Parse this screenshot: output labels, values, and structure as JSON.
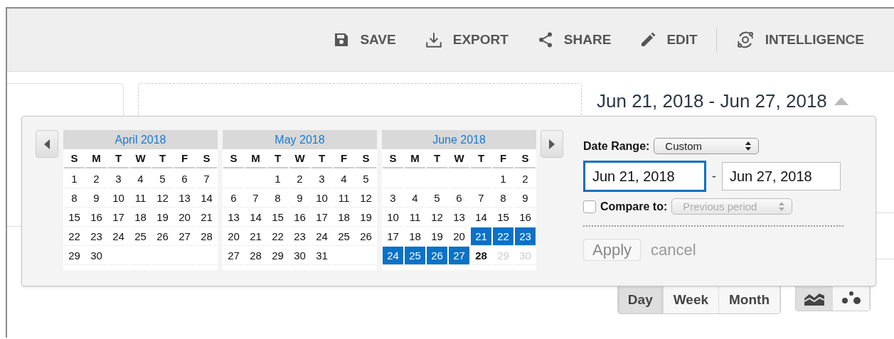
{
  "toolbar": [
    {
      "kind": "save",
      "label": "SAVE"
    },
    {
      "kind": "export",
      "label": "EXPORT"
    },
    {
      "kind": "share",
      "label": "SHARE"
    },
    {
      "kind": "edit",
      "label": "EDIT"
    },
    {
      "kind": "intelligence",
      "label": "INTELLIGENCE"
    }
  ],
  "date_range_display": "Jun 21, 2018 - Jun 27, 2018",
  "picker": {
    "months": [
      {
        "title": "April 2018",
        "weekdays": [
          "S",
          "M",
          "T",
          "W",
          "T",
          "F",
          "S"
        ],
        "weeks": [
          {
            "kind": "full",
            "days": [
              {
                "d": "1",
                "kind": "day",
                "selected": false
              },
              {
                "d": "2",
                "kind": "day",
                "selected": false
              },
              {
                "d": "3",
                "kind": "day",
                "selected": false
              },
              {
                "d": "4",
                "kind": "day",
                "selected": false
              },
              {
                "d": "5",
                "kind": "day",
                "selected": false
              },
              {
                "d": "6",
                "kind": "day",
                "selected": false
              },
              {
                "d": "7",
                "kind": "day",
                "selected": false
              }
            ]
          },
          {
            "kind": "full",
            "days": [
              {
                "d": "8",
                "kind": "day",
                "selected": false
              },
              {
                "d": "9",
                "kind": "day",
                "selected": false
              },
              {
                "d": "10",
                "kind": "day",
                "selected": false
              },
              {
                "d": "11",
                "kind": "day",
                "selected": false
              },
              {
                "d": "12",
                "kind": "day",
                "selected": false
              },
              {
                "d": "13",
                "kind": "day",
                "selected": false
              },
              {
                "d": "14",
                "kind": "day",
                "selected": false
              }
            ]
          },
          {
            "kind": "full",
            "days": [
              {
                "d": "15",
                "kind": "day",
                "selected": false
              },
              {
                "d": "16",
                "kind": "day",
                "selected": false
              },
              {
                "d": "17",
                "kind": "day",
                "selected": false
              },
              {
                "d": "18",
                "kind": "day",
                "selected": false
              },
              {
                "d": "19",
                "kind": "day",
                "selected": false
              },
              {
                "d": "20",
                "kind": "day",
                "selected": false
              },
              {
                "d": "21",
                "kind": "day",
                "selected": false
              }
            ]
          },
          {
            "kind": "full",
            "days": [
              {
                "d": "22",
                "kind": "day",
                "selected": false
              },
              {
                "d": "23",
                "kind": "day",
                "selected": false
              },
              {
                "d": "24",
                "kind": "day",
                "selected": false
              },
              {
                "d": "25",
                "kind": "day",
                "selected": false
              },
              {
                "d": "26",
                "kind": "day",
                "selected": false
              },
              {
                "d": "27",
                "kind": "day",
                "selected": false
              },
              {
                "d": "28",
                "kind": "day",
                "selected": false
              }
            ]
          },
          {
            "kind": "trail",
            "days": [
              {
                "d": "29",
                "kind": "day",
                "selected": false
              },
              {
                "d": "30",
                "kind": "day",
                "selected": false
              }
            ]
          }
        ]
      },
      {
        "title": "May 2018",
        "weekdays": [
          "S",
          "M",
          "T",
          "W",
          "T",
          "F",
          "S"
        ],
        "weeks": [
          {
            "kind": "lead",
            "days": [
              {
                "d": "1",
                "kind": "day",
                "selected": false
              },
              {
                "d": "2",
                "kind": "day",
                "selected": false
              },
              {
                "d": "3",
                "kind": "day",
                "selected": false
              },
              {
                "d": "4",
                "kind": "day",
                "selected": false
              },
              {
                "d": "5",
                "kind": "day",
                "selected": false
              }
            ]
          },
          {
            "kind": "full",
            "days": [
              {
                "d": "6",
                "kind": "day",
                "selected": false
              },
              {
                "d": "7",
                "kind": "day",
                "selected": false
              },
              {
                "d": "8",
                "kind": "day",
                "selected": false
              },
              {
                "d": "9",
                "kind": "day",
                "selected": false
              },
              {
                "d": "10",
                "kind": "day",
                "selected": false
              },
              {
                "d": "11",
                "kind": "day",
                "selected": false
              },
              {
                "d": "12",
                "kind": "day",
                "selected": false
              }
            ]
          },
          {
            "kind": "full",
            "days": [
              {
                "d": "13",
                "kind": "day",
                "selected": false
              },
              {
                "d": "14",
                "kind": "day",
                "selected": false
              },
              {
                "d": "15",
                "kind": "day",
                "selected": false
              },
              {
                "d": "16",
                "kind": "day",
                "selected": false
              },
              {
                "d": "17",
                "kind": "day",
                "selected": false
              },
              {
                "d": "18",
                "kind": "day",
                "selected": false
              },
              {
                "d": "19",
                "kind": "day",
                "selected": false
              }
            ]
          },
          {
            "kind": "full",
            "days": [
              {
                "d": "20",
                "kind": "day",
                "selected": false
              },
              {
                "d": "21",
                "kind": "day",
                "selected": false
              },
              {
                "d": "22",
                "kind": "day",
                "selected": false
              },
              {
                "d": "23",
                "kind": "day",
                "selected": false
              },
              {
                "d": "24",
                "kind": "day",
                "selected": false
              },
              {
                "d": "25",
                "kind": "day",
                "selected": false
              },
              {
                "d": "26",
                "kind": "day",
                "selected": false
              }
            ]
          },
          {
            "kind": "trail",
            "days": [
              {
                "d": "27",
                "kind": "day",
                "selected": false
              },
              {
                "d": "28",
                "kind": "day",
                "selected": false
              },
              {
                "d": "29",
                "kind": "day",
                "selected": false
              },
              {
                "d": "30",
                "kind": "day",
                "selected": false
              },
              {
                "d": "31",
                "kind": "day",
                "selected": false
              }
            ]
          }
        ]
      },
      {
        "title": "June 2018",
        "weekdays": [
          "S",
          "M",
          "T",
          "W",
          "T",
          "F",
          "S"
        ],
        "weeks": [
          {
            "kind": "lead",
            "days": [
              {
                "d": "1",
                "kind": "day",
                "selected": false
              },
              {
                "d": "2",
                "kind": "day",
                "selected": false
              }
            ]
          },
          {
            "kind": "full",
            "days": [
              {
                "d": "3",
                "kind": "day",
                "selected": false
              },
              {
                "d": "4",
                "kind": "day",
                "selected": false
              },
              {
                "d": "5",
                "kind": "day",
                "selected": false
              },
              {
                "d": "6",
                "kind": "day",
                "selected": false
              },
              {
                "d": "7",
                "kind": "day",
                "selected": false
              },
              {
                "d": "8",
                "kind": "day",
                "selected": false
              },
              {
                "d": "9",
                "kind": "day",
                "selected": false
              }
            ]
          },
          {
            "kind": "full",
            "days": [
              {
                "d": "10",
                "kind": "day",
                "selected": false
              },
              {
                "d": "11",
                "kind": "day",
                "selected": false
              },
              {
                "d": "12",
                "kind": "day",
                "selected": false
              },
              {
                "d": "13",
                "kind": "day",
                "selected": false
              },
              {
                "d": "14",
                "kind": "day",
                "selected": false
              },
              {
                "d": "15",
                "kind": "day",
                "selected": false
              },
              {
                "d": "16",
                "kind": "day",
                "selected": false
              }
            ]
          },
          {
            "kind": "full",
            "days": [
              {
                "d": "17",
                "kind": "day",
                "selected": false
              },
              {
                "d": "18",
                "kind": "day",
                "selected": false
              },
              {
                "d": "19",
                "kind": "day",
                "selected": false
              },
              {
                "d": "20",
                "kind": "day",
                "selected": false
              },
              {
                "d": "21",
                "kind": "day",
                "selected": true
              },
              {
                "d": "22",
                "kind": "day",
                "selected": true
              },
              {
                "d": "23",
                "kind": "day",
                "selected": true
              }
            ]
          },
          {
            "kind": "full",
            "days": [
              {
                "d": "24",
                "kind": "day",
                "selected": true
              },
              {
                "d": "25",
                "kind": "day",
                "selected": true
              },
              {
                "d": "26",
                "kind": "day",
                "selected": true
              },
              {
                "d": "27",
                "kind": "day",
                "selected": true
              },
              {
                "d": "28",
                "kind": "today",
                "selected": false
              },
              {
                "d": "29",
                "kind": "future",
                "selected": false
              },
              {
                "d": "30",
                "kind": "future",
                "selected": false
              }
            ]
          }
        ]
      }
    ],
    "date_range_label": "Date Range:",
    "date_range_select": "Custom",
    "start_date": "Jun 21, 2018",
    "start_focused": true,
    "separator": "-",
    "end_date": "Jun 27, 2018",
    "compare": {
      "checked": false,
      "label": "Compare to:",
      "select": "Previous period",
      "disabled": true
    },
    "apply": "Apply",
    "cancel": "cancel"
  },
  "granularity": [
    {
      "label": "Day",
      "selected": true
    },
    {
      "label": "Week",
      "selected": false
    },
    {
      "label": "Month",
      "selected": false
    }
  ],
  "chart_types": [
    {
      "kind": "line",
      "selected": true
    },
    {
      "kind": "bubble",
      "selected": false
    }
  ]
}
